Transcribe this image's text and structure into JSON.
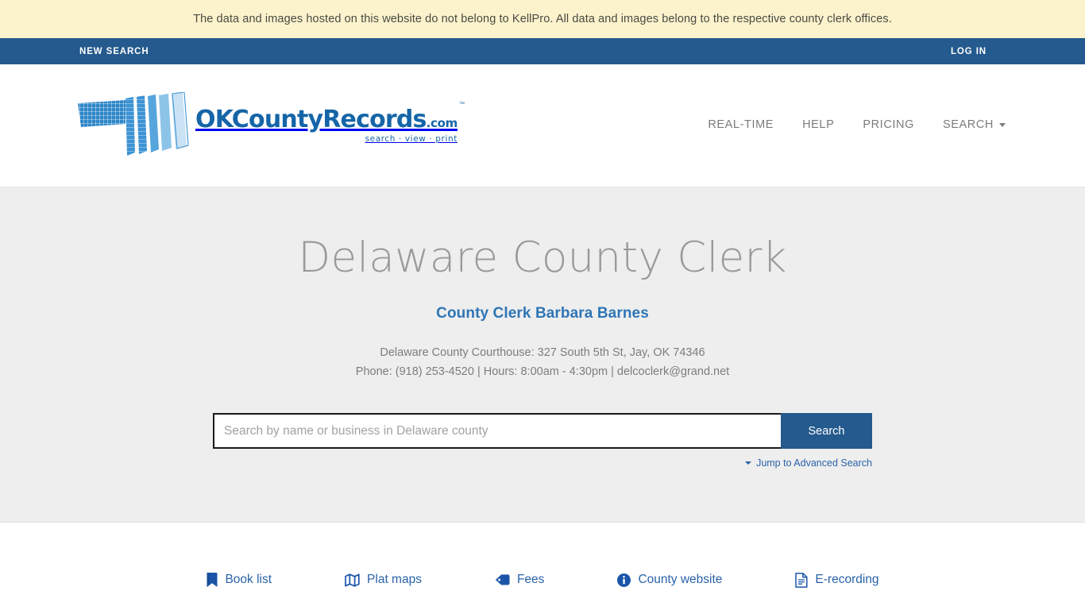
{
  "notice": {
    "text": "The data and images hosted on this website do not belong to KellPro. All data and images belong to the respective county clerk offices."
  },
  "utility_bar": {
    "new_search_label": "NEW SEARCH",
    "log_in_label": "LOG IN"
  },
  "logo": {
    "word_main": "OKCountyRecords",
    "word_tld": ".com",
    "tagline": "search · view · print",
    "trademark": "™"
  },
  "nav": {
    "items": [
      {
        "label": "REAL-TIME",
        "has_caret": false
      },
      {
        "label": "HELP",
        "has_caret": false
      },
      {
        "label": "PRICING",
        "has_caret": false
      },
      {
        "label": "SEARCH",
        "has_caret": true
      }
    ]
  },
  "hero": {
    "title": "Delaware County Clerk",
    "subtitle": "County Clerk Barbara Barnes",
    "address_line1": "Delaware County Courthouse: 327 South 5th St, Jay, OK 74346",
    "address_line2": "Phone: (918) 253-4520 | Hours: 8:00am - 4:30pm | delcoclerk@grand.net"
  },
  "search": {
    "placeholder": "Search by name or business in Delaware county",
    "value": "",
    "button_label": "Search",
    "advanced_label": "Jump to Advanced Search"
  },
  "quick_links": [
    {
      "label": "Book list",
      "icon": "book-icon"
    },
    {
      "label": "Plat maps",
      "icon": "map-icon"
    },
    {
      "label": "Fees",
      "icon": "tag-icon"
    },
    {
      "label": "County website",
      "icon": "info-circle-icon"
    },
    {
      "label": "E-recording",
      "icon": "document-icon"
    }
  ],
  "colors": {
    "banner_bg": "#fcf3cd",
    "nav_bar_bg": "#245a8d",
    "link_blue": "#2a62a8",
    "accent_blue": "#2e75b6",
    "hero_bg": "#eeeeee",
    "logo_blue": "#1565a8"
  }
}
